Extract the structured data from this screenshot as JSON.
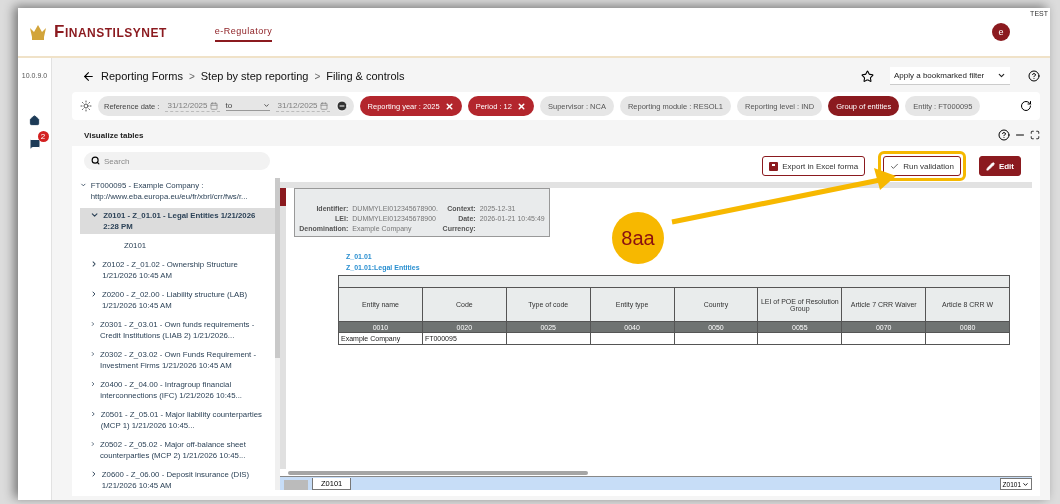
{
  "header": {
    "brand": "Finanstilsynet",
    "nav": [
      {
        "label": "e-Regulatory",
        "selected": true
      }
    ],
    "avatar": "e",
    "environment": "TEST"
  },
  "sidebar": {
    "version": "10.0.9.0",
    "items": [
      {
        "kind": "home"
      },
      {
        "kind": "messages",
        "badge": "2"
      }
    ]
  },
  "breadcrumbs": {
    "separator": ">",
    "items": [
      "Reporting Forms",
      "Step by step reporting",
      "Filing & controls"
    ]
  },
  "bookmark_filter": {
    "value": "Apply a bookmarked filter"
  },
  "filters": {
    "date_label": "Reference date :",
    "from": "31/12/2025",
    "to_label": "to",
    "to": "31/12/2025",
    "chips": [
      {
        "label": "Reporting year : 2025",
        "kind": "removable",
        "selected": true
      },
      {
        "label": "Period : 12",
        "kind": "removable",
        "selected": true
      },
      {
        "label": "Supervisor : NCA",
        "kind": "option",
        "selected": false
      },
      {
        "label": "Reporting module : RESOL1",
        "kind": "option",
        "selected": false
      },
      {
        "label": "Reporting level : IND",
        "kind": "option",
        "selected": false
      },
      {
        "label": "Group of entities",
        "kind": "option",
        "selected": true
      },
      {
        "label": "Entity : FT000095",
        "kind": "option",
        "selected": false
      }
    ]
  },
  "panel": {
    "title": "Visualize tables",
    "search": {
      "placeholder": "Search"
    },
    "tree": [
      {
        "label": "FT000095 - Example Company : http://www.eba.europa.eu/eu/fr/xbrl/crr/fws/r...",
        "expanded": true,
        "selected": false,
        "children": [
          {
            "label": "Z0101 - Z_01.01 - Legal Entities 1/21/2026 2:28 PM",
            "expanded": true,
            "selected": true,
            "children": [
              {
                "label": "Z0101",
                "selected": false
              }
            ]
          },
          {
            "label": "Z0102 - Z_01.02 - Ownership Structure 1/21/2026 10:45 AM",
            "expanded": false,
            "selected": false
          },
          {
            "label": "Z0200 - Z_02.00 - Liability structure (LAB) 1/21/2026 10:45 AM",
            "expanded": false,
            "selected": false
          },
          {
            "label": "Z0301 - Z_03.01 - Own funds requirements - Credit Institutions (LIAB 2) 1/21/2026...",
            "expanded": false,
            "selected": false
          },
          {
            "label": "Z0302 - Z_03.02 - Own Funds Requirement - Investment Firms 1/21/2026 10:45 AM",
            "expanded": false,
            "selected": false
          },
          {
            "label": "Z0400 - Z_04.00 - Intragroup financial interconnections (IFC) 1/21/2026 10:45...",
            "expanded": false,
            "selected": false
          },
          {
            "label": "Z0501 - Z_05.01 - Major liability counterparties (MCP 1) 1/21/2026 10:45...",
            "expanded": false,
            "selected": false
          },
          {
            "label": "Z0502 - Z_05.02 - Major off-balance sheet counterparties (MCP 2) 1/21/2026 10:45...",
            "expanded": false,
            "selected": false
          },
          {
            "label": "Z0600 - Z_06.00 - Deposit insurance (DIS) 1/21/2026 10:45 AM",
            "expanded": false,
            "selected": false
          }
        ]
      }
    ],
    "viewer": {
      "buttons": [
        {
          "label": "Export in Excel forma",
          "kind": "export",
          "highlighted": false
        },
        {
          "label": "Run validation",
          "kind": "validate",
          "highlighted": true
        },
        {
          "label": "Edit",
          "kind": "edit",
          "highlighted": false
        }
      ],
      "info": {
        "left": [
          {
            "label": "Identifier:",
            "value": "DUMMYLEI012345678900."
          },
          {
            "label": "LEI:",
            "value": "DUMMYLEI012345678900"
          },
          {
            "label": "Denomination:",
            "value": "Example Company"
          }
        ],
        "right": [
          {
            "label": "Context:",
            "value": "2025-12-31"
          },
          {
            "label": "Date:",
            "value": "2026-01-21 10:45:49"
          },
          {
            "label": "Currency:"
          }
        ]
      },
      "sheet_code": "Z_01.01",
      "sheet_title": "Z_01.01:Legal Entities",
      "grid": {
        "columns": [
          {
            "name": "Entity name",
            "code": "0010"
          },
          {
            "name": "Code",
            "code": "0020"
          },
          {
            "name": "Type of code",
            "code": "0025"
          },
          {
            "name": "Entity type",
            "code": "0040"
          },
          {
            "name": "Country",
            "code": "0050"
          },
          {
            "name": "LEI of POE of Resolution Group",
            "code": "0055"
          },
          {
            "name": "Article 7 CRR Waiver",
            "code": "0070"
          },
          {
            "name": "Article 8 CRR W",
            "code": "0080"
          }
        ],
        "rows": [
          [
            "Example Company",
            "FT000095"
          ]
        ]
      },
      "sheet_tabs": [
        {
          "label": "Z0101",
          "selected": true
        }
      ],
      "sheet_select": "Z0101"
    }
  },
  "annotation": {
    "label": "8aa"
  }
}
